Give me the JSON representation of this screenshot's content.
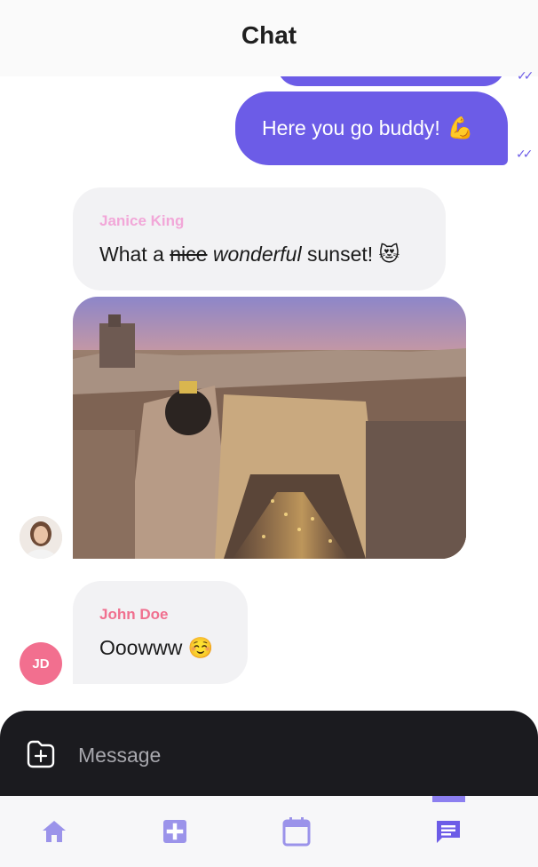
{
  "header": {
    "title": "Chat"
  },
  "messages": {
    "outgoing_main": {
      "text": "Here you go buddy!",
      "emoji": "💪"
    },
    "janice": {
      "sender": "Janice King",
      "text_before": "What a ",
      "strike": "nice",
      "space": " ",
      "italic": "wonderful",
      "text_after": " sunset! ",
      "emoji": "😻"
    },
    "john": {
      "sender": "John Doe",
      "text": "Ooowww",
      "emoji": "☺️",
      "initials": "JD"
    }
  },
  "composer": {
    "placeholder": "Message"
  },
  "nav": {
    "items": [
      "home-icon",
      "medical-plus-icon",
      "calendar-icon",
      "chat-icon"
    ],
    "active": "chat-icon"
  },
  "colors": {
    "accent": "#6c5ce7",
    "janice_name": "#f2a7d8",
    "john_name": "#f0708f",
    "avatar_jd": "#f26f8f",
    "composer_bg": "#1b1b1f"
  }
}
